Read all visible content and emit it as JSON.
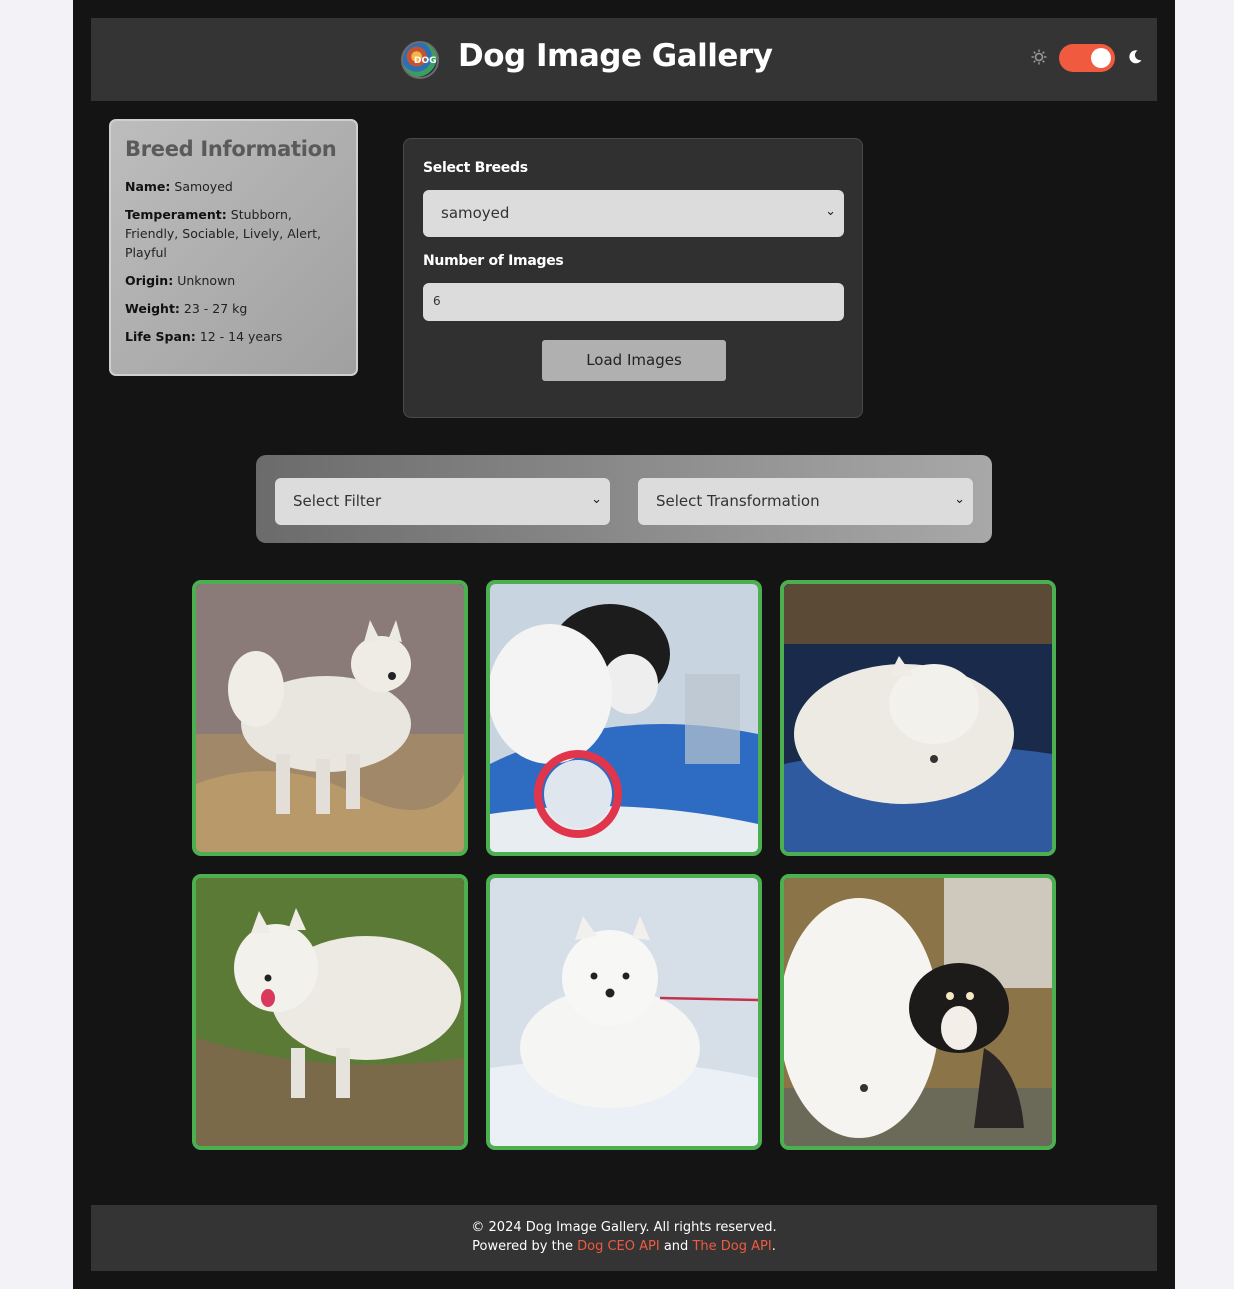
{
  "header": {
    "logo_text": "DOG",
    "title": "Dog Image Gallery",
    "theme_toggle_on": true
  },
  "breed_info": {
    "heading": "Breed Information",
    "name_label": "Name:",
    "name": "Samoyed",
    "temperament_label": "Temperament:",
    "temperament": "Stubborn, Friendly, Sociable, Lively, Alert, Playful",
    "origin_label": "Origin:",
    "origin": "Unknown",
    "weight_label": "Weight:",
    "weight": "23 - 27 kg",
    "lifespan_label": "Life Span:",
    "lifespan": "12 - 14 years"
  },
  "form": {
    "breeds_label": "Select Breeds",
    "breed_selected": "samoyed",
    "count_label": "Number of Images",
    "count_value": "6",
    "load_button": "Load Images"
  },
  "filters": {
    "filter_selected": "Select Filter",
    "transformation_selected": "Select Transformation"
  },
  "gallery": {
    "images": [
      {
        "subject": "samoyed standing in shallow water"
      },
      {
        "subject": "samoyed puppy and black-and-white dog with frisbee"
      },
      {
        "subject": "samoyed lying on blue rug"
      },
      {
        "subject": "samoyed on grass with tongue out"
      },
      {
        "subject": "samoyed puppy in snow"
      },
      {
        "subject": "samoyed playing with tricolor dog"
      }
    ]
  },
  "footer": {
    "copyright": "© 2024 Dog Image Gallery. All rights reserved.",
    "powered_prefix": "Powered by the",
    "link1": "Dog CEO API",
    "and_text": "and",
    "link2": "The Dog API",
    "suffix": "."
  },
  "colors": {
    "accent": "#f05a3f",
    "tile_border": "#4caf50",
    "background": "#141414"
  }
}
